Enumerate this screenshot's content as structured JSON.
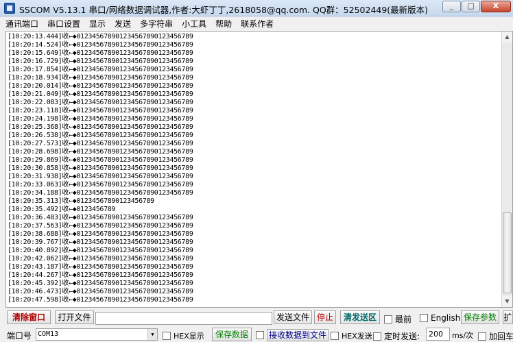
{
  "window": {
    "title": "SSCOM V5.13.1 串口/网络数据调试器,作者:大虾丁丁,2618058@qq.com. QQ群：52502449(最新版本)",
    "minimize": "_",
    "maximize": "□",
    "close": "X"
  },
  "menu": [
    "通讯端口",
    "串口设置",
    "显示",
    "发送",
    "多字符串",
    "小工具",
    "帮助",
    "联系作者"
  ],
  "log": {
    "lines": [
      "[10:20:13.444]收←◆012345678901234567890123456789",
      "[10:20:14.524]收←◆012345678901234567890123456789",
      "[10:20:15.649]收←◆012345678901234567890123456789",
      "[10:20:16.729]收←◆012345678901234567890123456789",
      "[10:20:17.854]收←◆012345678901234567890123456789",
      "[10:20:18.934]收←◆012345678901234567890123456789",
      "[10:20:20.014]收←◆012345678901234567890123456789",
      "[10:20:21.049]收←◆012345678901234567890123456789",
      "[10:20:22.083]收←◆012345678901234567890123456789",
      "[10:20:23.118]收←◆012345678901234567890123456789",
      "[10:20:24.198]收←◆012345678901234567890123456789",
      "[10:20:25.368]收←◆012345678901234567890123456789",
      "[10:20:26.538]收←◆012345678901234567890123456789",
      "[10:20:27.573]收←◆012345678901234567890123456789",
      "[10:20:28.698]收←◆012345678901234567890123456789",
      "[10:20:29.869]收←◆012345678901234567890123456789",
      "[10:20:30.858]收←◆012345678901234567890123456789",
      "[10:20:31.938]收←◆012345678901234567890123456789",
      "[10:20:33.063]收←◆012345678901234567890123456789",
      "[10:20:34.188]收←◆012345678901234567890123456789",
      "[10:20:35.313]收←◆01234567890123456789",
      "[10:20:35.492]收←◆0123456789",
      "[10:20:36.483]收←◆012345678901234567890123456789",
      "[10:20:37.563]收←◆012345678901234567890123456789",
      "[10:20:38.688]收←◆012345678901234567890123456789",
      "[10:20:39.767]收←◆012345678901234567890123456789",
      "[10:20:40.892]收←◆012345678901234567890123456789",
      "[10:20:42.062]收←◆012345678901234567890123456789",
      "[10:20:43.187]收←◆012345678901234567890123456789",
      "[10:20:44.267]收←◆012345678901234567890123456789",
      "[10:20:45.392]收←◆012345678901234567890123456789",
      "[10:20:46.473]收←◆012345678901234567890123456789",
      "[10:20:47.598]收←◆012345678901234567890123456789"
    ]
  },
  "toolbar": {
    "clear_window": "清除窗口",
    "open_file": "打开文件",
    "send_file": "发送文件",
    "stop": "停止",
    "clear_send": "清发送区",
    "topmost": "最前",
    "english": "English",
    "save_params": "保存参数",
    "expand": "扩"
  },
  "portbar": {
    "port_label": "端口号",
    "port_value": "COM13",
    "hex_display": "HEX显示",
    "save_data": "保存数据",
    "recv_to_file": "接收数据到文件",
    "hex_send": "HEX发送",
    "timed_send": "定时发送:",
    "interval": "200",
    "interval_unit": "ms/次",
    "add_crlf": "加回车"
  },
  "colors": {
    "red_button": "#b00000",
    "green_button": "#008000",
    "teal_button": "#006b6b"
  }
}
